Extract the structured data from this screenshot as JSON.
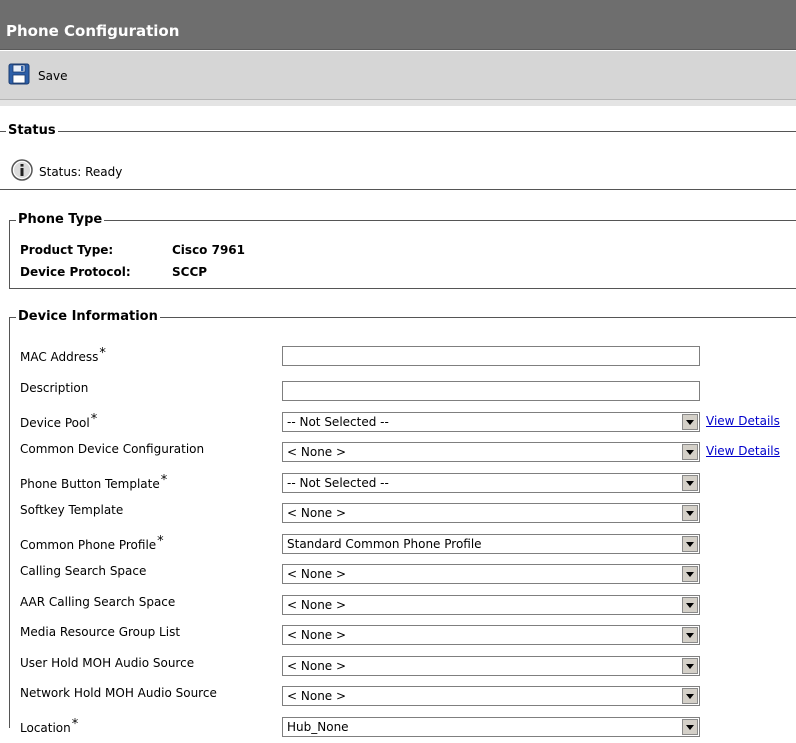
{
  "header": {
    "title": "Phone Configuration"
  },
  "toolbar": {
    "save_label": "Save"
  },
  "status": {
    "legend": "Status",
    "text": "Status: Ready"
  },
  "phone_type": {
    "legend": "Phone Type",
    "product_type_label": "Product Type:",
    "product_type_value": "Cisco 7961",
    "device_protocol_label": "Device Protocol:",
    "device_protocol_value": "SCCP"
  },
  "device_info": {
    "legend": "Device Information",
    "required_mark": "*",
    "view_details_label": "View Details",
    "fields": [
      {
        "label": "MAC Address",
        "required": true,
        "type": "text",
        "value": ""
      },
      {
        "label": "Description",
        "required": false,
        "type": "text",
        "value": ""
      },
      {
        "label": "Device Pool",
        "required": true,
        "type": "select",
        "value": "-- Not Selected --",
        "link": true
      },
      {
        "label": "Common Device Configuration",
        "required": false,
        "type": "select",
        "value": "< None >",
        "link": true
      },
      {
        "label": "Phone Button Template",
        "required": true,
        "type": "select",
        "value": "-- Not Selected --"
      },
      {
        "label": "Softkey Template",
        "required": false,
        "type": "select",
        "value": "< None >"
      },
      {
        "label": "Common Phone Profile",
        "required": true,
        "type": "select",
        "value": "Standard Common Phone Profile"
      },
      {
        "label": "Calling Search Space",
        "required": false,
        "type": "select",
        "value": "< None >"
      },
      {
        "label": "AAR Calling Search Space",
        "required": false,
        "type": "select",
        "value": "< None >"
      },
      {
        "label": "Media Resource Group List",
        "required": false,
        "type": "select",
        "value": "< None >"
      },
      {
        "label": "User Hold MOH Audio Source",
        "required": false,
        "type": "select",
        "value": "< None >"
      },
      {
        "label": "Network Hold MOH Audio Source",
        "required": false,
        "type": "select",
        "value": "< None >"
      },
      {
        "label": "Location",
        "required": true,
        "type": "select",
        "value": "Hub_None"
      }
    ]
  }
}
